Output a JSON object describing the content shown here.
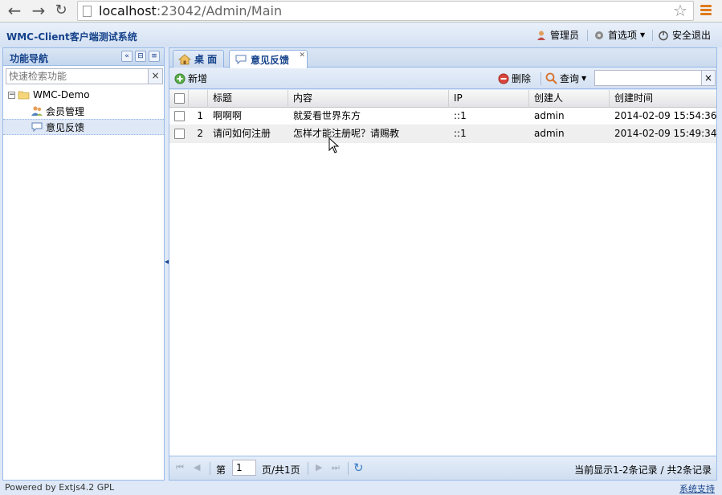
{
  "browser": {
    "url_host": "localhost",
    "url_rest": ":23042/Admin/Main"
  },
  "app": {
    "title": "WMC-Client客户端测试系统",
    "user_label": "管理员",
    "prefs_label": "首选项",
    "logout_label": "安全退出"
  },
  "nav": {
    "title": "功能导航",
    "search_placeholder": "快速检索功能",
    "clear_icon": "×",
    "tree": {
      "root": "WMC-Demo",
      "items": [
        {
          "label": "会员管理",
          "icon": "users-icon"
        },
        {
          "label": "意见反馈",
          "icon": "comment-icon"
        }
      ]
    }
  },
  "tabs": [
    {
      "label": "桌 面",
      "icon": "home-icon"
    },
    {
      "label": "意见反馈",
      "icon": "comment-icon"
    }
  ],
  "toolbar": {
    "add_label": "新增",
    "delete_label": "删除",
    "query_label": "查询",
    "search_value": "",
    "clear_icon": "×"
  },
  "grid": {
    "columns": [
      "标题",
      "内容",
      "IP",
      "创建人",
      "创建时间"
    ],
    "rows": [
      {
        "num": "1",
        "title": "啊啊啊",
        "content": "就爱看世界东方",
        "ip": "::1",
        "creator": "admin",
        "time": "2014-02-09 15:54:36"
      },
      {
        "num": "2",
        "title": "请问如何注册",
        "content": "怎样才能注册呢？请赐教",
        "ip": "::1",
        "creator": "admin",
        "time": "2014-02-09 15:49:34"
      }
    ]
  },
  "pager": {
    "page_prefix": "第",
    "page_value": "1",
    "page_suffix": "页/共1页",
    "info": "当前显示1-2条记录 / 共2条记录"
  },
  "footer": {
    "left": "Powered by Extjs4.2 GPL",
    "right": "系统支持"
  },
  "colors": {
    "accent": "#15428b",
    "panel_border": "#99bbe8",
    "background": "#dfe8f6"
  }
}
